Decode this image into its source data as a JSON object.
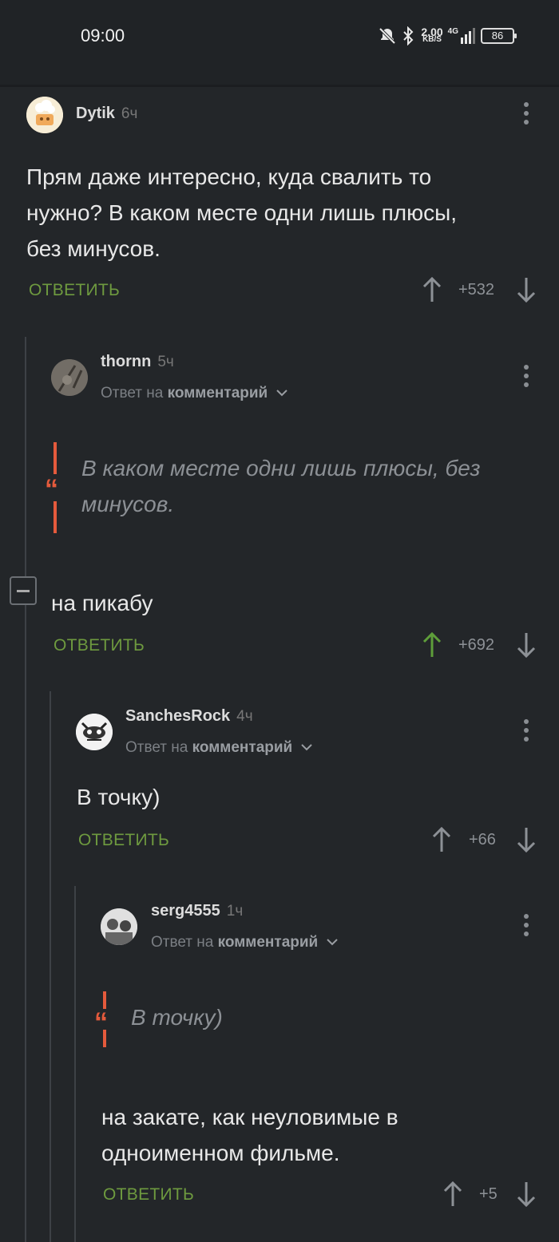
{
  "status_bar": {
    "time": "09:00",
    "net_speed": "2.00",
    "net_unit": "KB/S",
    "network": "4G",
    "battery": "86"
  },
  "comments": [
    {
      "author": "Dytik",
      "age": "6ч",
      "text_lines": [
        "Прям даже интересно, куда свалить то",
        "нужно? В каком месте одни лишь плюсы,",
        "без минусов."
      ],
      "reply_label": "ОТВЕТИТЬ",
      "votes": "+532",
      "upvoted": false
    },
    {
      "author": "thornn",
      "age": "5ч",
      "reply_prefix": "Ответ на",
      "reply_target": "комментарий",
      "quote_lines": [
        "В каком месте одни лишь плюсы, без",
        "минусов."
      ],
      "text": "на пикабу",
      "reply_label": "ОТВЕТИТЬ",
      "votes": "+692",
      "upvoted": true
    },
    {
      "author": "SanchesRock",
      "age": "4ч",
      "reply_prefix": "Ответ на",
      "reply_target": "комментарий",
      "text": "В точку)",
      "reply_label": "ОТВЕТИТЬ",
      "votes": "+66",
      "upvoted": false
    },
    {
      "author": "serg4555",
      "age": "1ч",
      "reply_prefix": "Ответ на",
      "reply_target": "комментарий",
      "quote_lines": [
        "В точку)"
      ],
      "text_lines": [
        "на закате, как неуловимые в",
        "одноименном фильме."
      ],
      "reply_label": "ОТВЕТИТЬ",
      "votes": "+5",
      "upvoted": false
    }
  ],
  "colors": {
    "background": "#232629",
    "reply_green": "#6e9a3f",
    "quote_red": "#e45a3c",
    "upvote_active": "#5e9e3a"
  }
}
